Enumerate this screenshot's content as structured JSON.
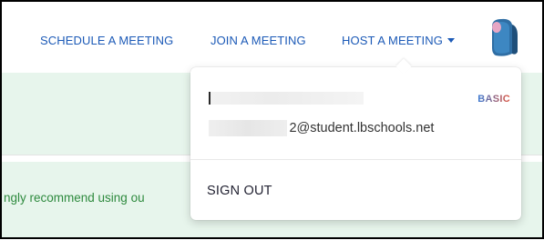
{
  "nav": {
    "schedule_label": "SCHEDULE A MEETING",
    "join_label": "JOIN A MEETING",
    "host_label": "HOST A MEETING"
  },
  "page": {
    "notice_text": "ngly recommend using ou"
  },
  "account_menu": {
    "email_suffix": "2@student.lbschools.net",
    "plan_badge": "BASIC",
    "sign_out_label": "SIGN OUT"
  },
  "colors": {
    "nav_link": "#1c5ab7",
    "green_band": "#e7f5ec",
    "notice_green": "#2e8a3e",
    "plan_badge_start": "#3a7bd5",
    "plan_badge_end": "#e0533c"
  },
  "icons": {
    "host_caret": "caret-down-icon",
    "avatar": "user-avatar-icon"
  }
}
